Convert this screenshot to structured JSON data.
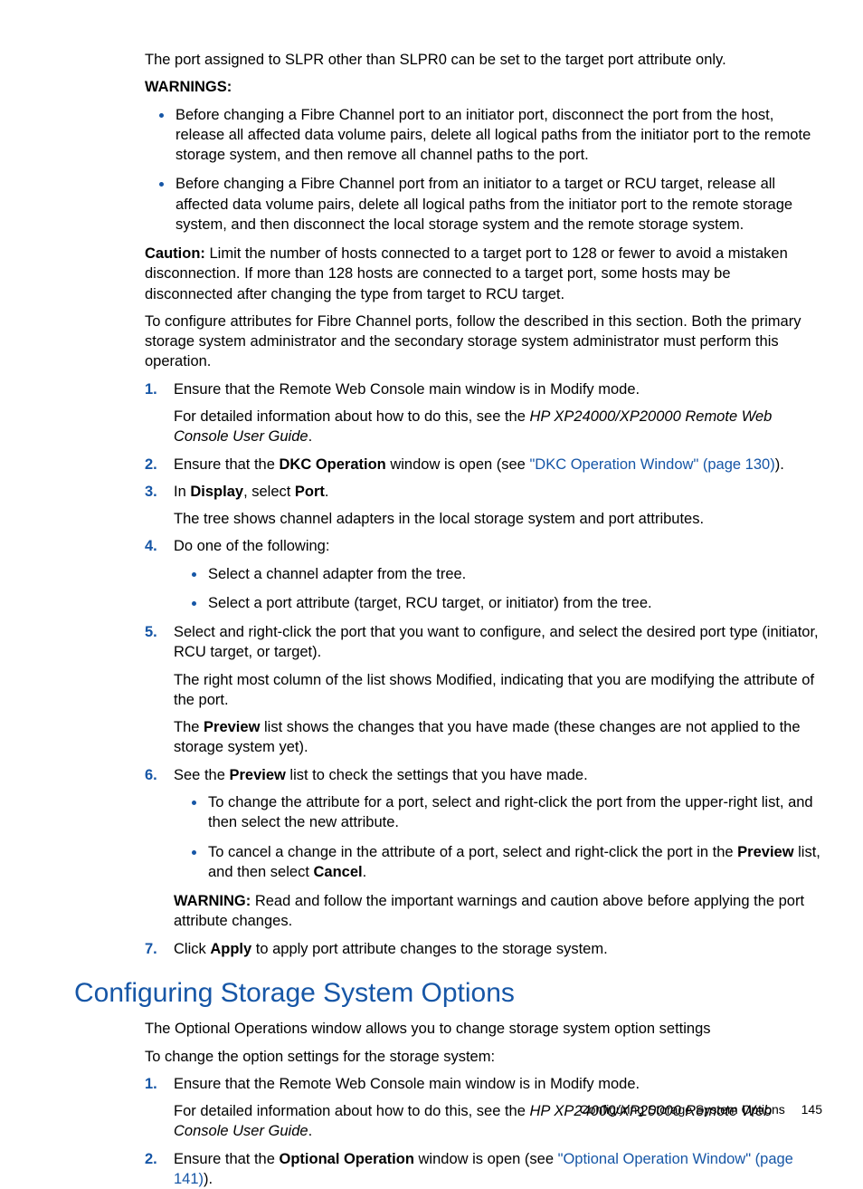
{
  "intro": "The port assigned to SLPR other than SLPR0 can be set to the target port attribute only.",
  "warnings_label": "WARNINGS:",
  "warn1": "Before changing a Fibre Channel port to an initiator port, disconnect the port from the host, release all affected data volume pairs, delete all logical paths from the initiator port to the remote storage system, and then remove all channel paths to the port.",
  "warn2": "Before changing a Fibre Channel port from an initiator to a target or RCU target, release all affected data volume pairs, delete all logical paths from the initiator port to the remote storage system, and then disconnect the local storage system and the remote storage system.",
  "caution_label": "Caution:",
  "caution_body": " Limit the number of hosts connected to a target port to 128 or fewer to avoid a mistaken disconnection. If more than 128 hosts are connected to a target port, some hosts may be disconnected after changing the type from target to RCU target.",
  "config_para": "To configure attributes for Fibre Channel ports, follow the described in this section. Both the primary storage system administrator and the secondary storage system administrator must perform this operation.",
  "s1": {
    "n": "1.",
    "a": "Ensure that the Remote Web Console main window is in Modify mode.",
    "b_pre": "For detailed information about how to do this, see the ",
    "b_it": "HP XP24000/XP20000 Remote Web Console User Guide",
    "b_post": "."
  },
  "s2": {
    "n": "2.",
    "a_pre": "Ensure that the ",
    "a_b": "DKC Operation",
    "a_mid": " window is open (see ",
    "a_link": "\"DKC Operation Window\" (page 130)",
    "a_post": ")."
  },
  "s3": {
    "n": "3.",
    "a_pre": "In ",
    "a_b1": "Display",
    "a_mid": ", select ",
    "a_b2": "Port",
    "a_post": ".",
    "b": "The tree shows channel adapters in the local storage system and port attributes."
  },
  "s4": {
    "n": "4.",
    "a": "Do one of the following:",
    "b1": "Select a channel adapter from the tree.",
    "b2": "Select a port attribute (target, RCU target, or initiator) from the tree."
  },
  "s5": {
    "n": "5.",
    "a": "Select and right-click the port that you want to configure, and select the desired port type (initiator, RCU target, or target).",
    "b": "The right most column of the list shows Modified, indicating that you are modifying the attribute of the port.",
    "c_pre": "The ",
    "c_b": "Preview",
    "c_post": " list shows the changes that you have made (these changes are not applied to the storage system yet)."
  },
  "s6": {
    "n": "6.",
    "a_pre": "See the ",
    "a_b": "Preview",
    "a_post": " list to check the settings that you have made.",
    "b1": "To change the attribute for a port, select and right-click the port from the upper-right list, and then select the new attribute.",
    "b2_pre": "To cancel a change in the attribute of a port, select and right-click the port in the ",
    "b2_b": "Preview",
    "b2_mid": " list, and then select ",
    "b2_b2": "Cancel",
    "b2_post": ".",
    "c_b": "WARNING:",
    "c_body": " Read and follow the important warnings and caution above before applying the port attribute changes."
  },
  "s7": {
    "n": "7.",
    "a_pre": "Click ",
    "a_b": "Apply",
    "a_post": " to apply port attribute changes to the storage system."
  },
  "h2": "Configuring Storage System Options",
  "sec2_p1": "The Optional Operations window allows you to change storage system option settings",
  "sec2_p2": "To change the option settings for the storage system:",
  "t1": {
    "n": "1.",
    "a": "Ensure that the Remote Web Console main window is in Modify mode.",
    "b_pre": "For detailed information about how to do this, see the ",
    "b_it": "HP XP24000/XP20000 Remote Web Console User Guide",
    "b_post": "."
  },
  "t2": {
    "n": "2.",
    "a_pre": "Ensure that the ",
    "a_b": "Optional Operation",
    "a_mid": " window is open (see ",
    "a_link": "\"Optional Operation Window\" (page 141)",
    "a_post": ")."
  },
  "footer_text": "Configuring Storage System Options",
  "page_num": "145"
}
